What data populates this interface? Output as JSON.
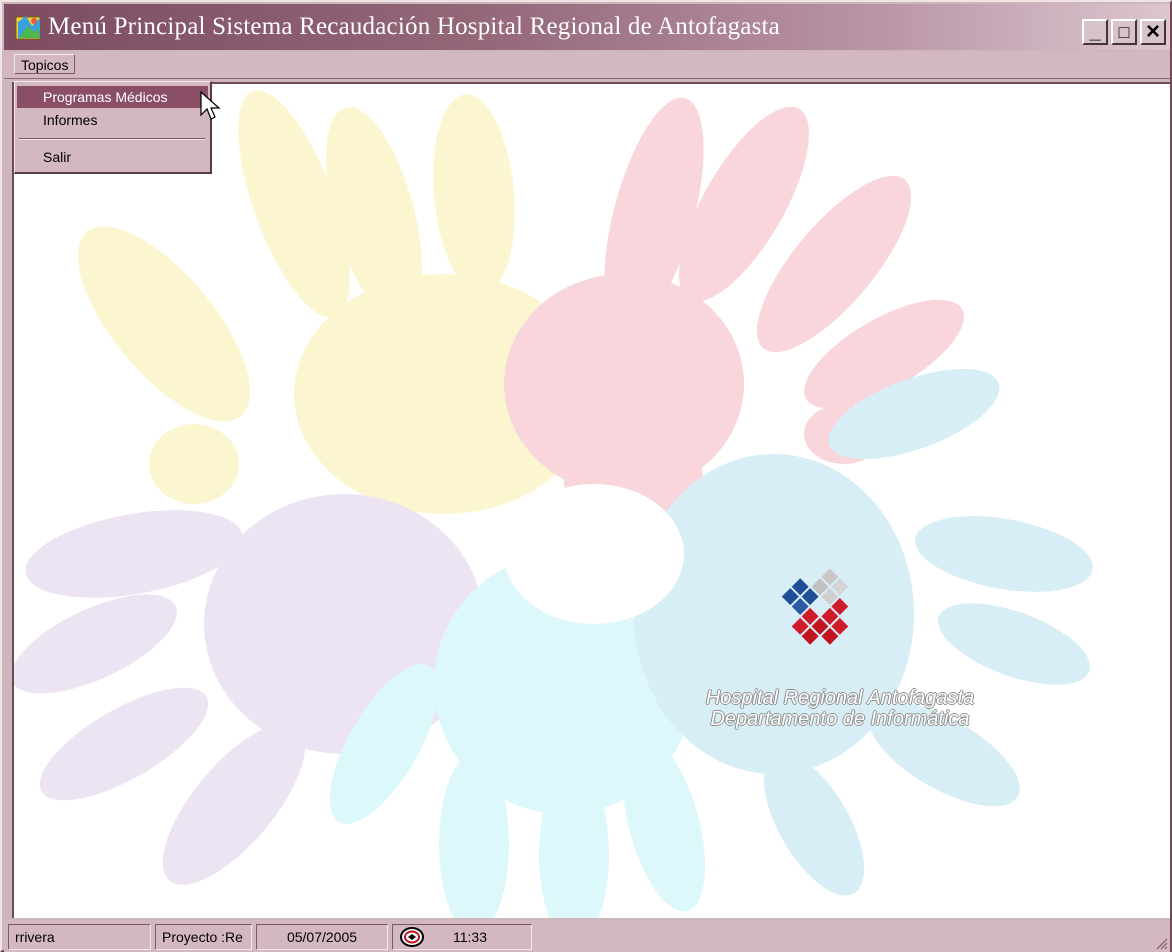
{
  "window": {
    "title": "Menú Principal Sistema Recaudación Hospital Regional de Antofagasta"
  },
  "window_controls": {
    "minimize": "_",
    "maximize": "□",
    "close": "×"
  },
  "menubar": {
    "menus": [
      {
        "label": "Topicos"
      }
    ]
  },
  "dropdown": {
    "items": [
      {
        "label": "Programas Médicos",
        "selected": true
      },
      {
        "label": "Informes"
      },
      {
        "label": "Salir"
      }
    ]
  },
  "logo": {
    "line1": "Hospital Regional Antofagasta",
    "line2": "Departamento de Informática",
    "colors": {
      "blue": "#1f4e96",
      "red": "#d01c2a",
      "gray": "#c8c8c8"
    }
  },
  "statusbar": {
    "user": "rrivera",
    "project": "Proyecto :Re",
    "date": "05/07/2005",
    "time": "11:33",
    "status_icon": "clock-icon"
  },
  "colors": {
    "titlebar": "#7d4c62",
    "menu": "#d4b8c1",
    "selection": "#8a4f66"
  }
}
